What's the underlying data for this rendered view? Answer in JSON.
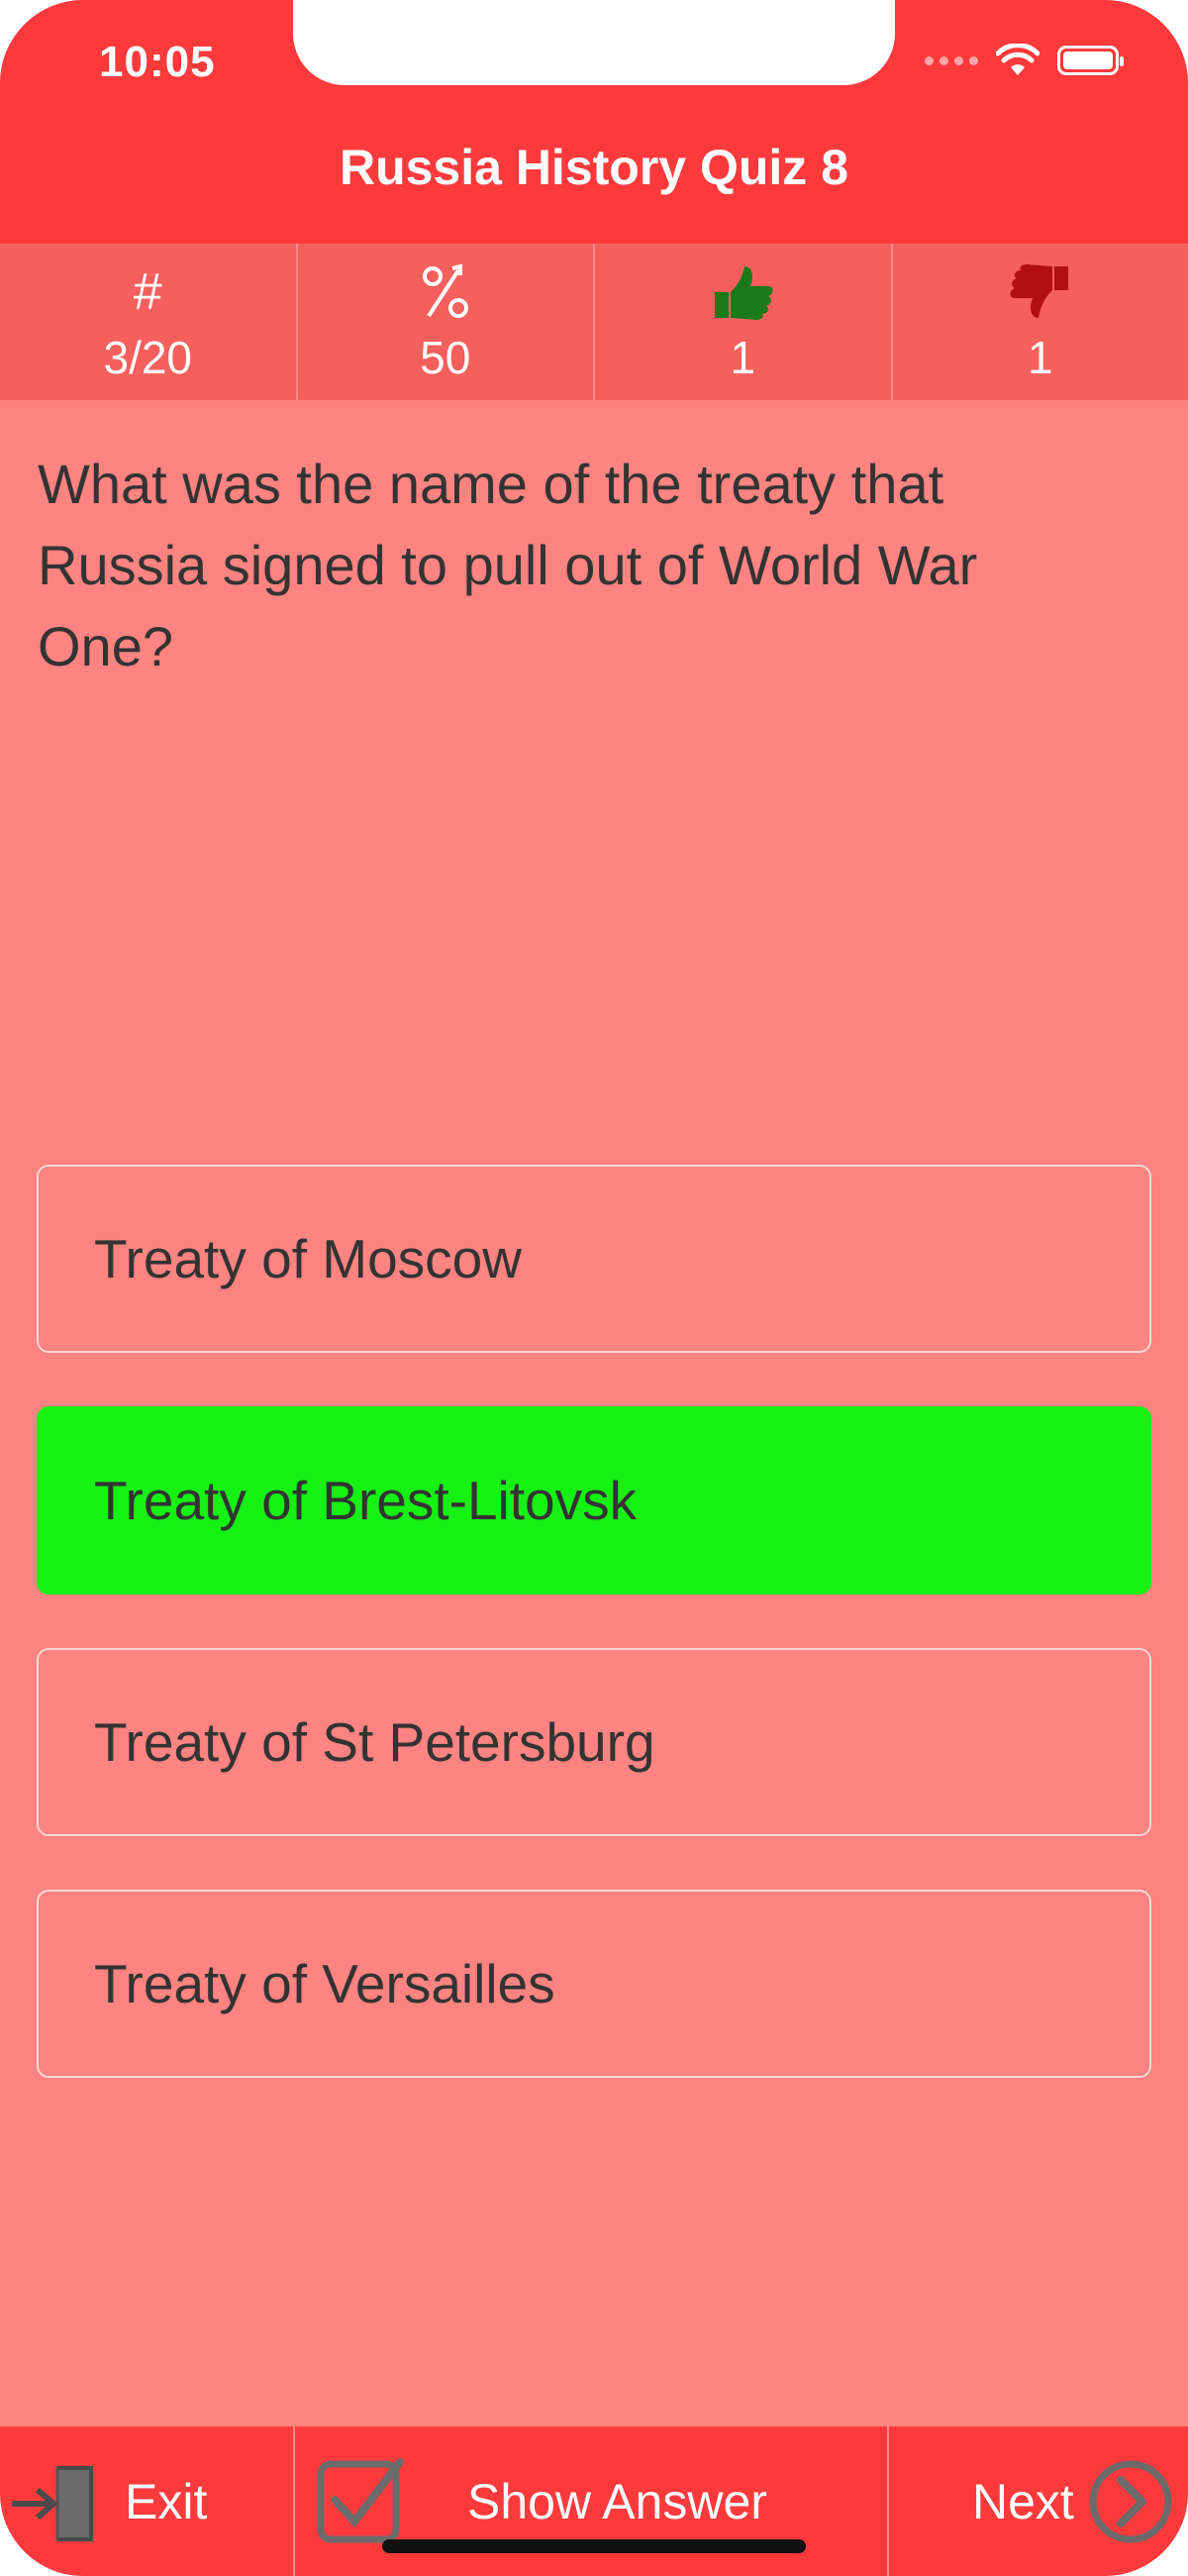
{
  "status_bar": {
    "time": "10:05"
  },
  "header": {
    "title": "Russia History Quiz 8"
  },
  "stats": [
    {
      "icon": "hash-icon",
      "symbol": "#",
      "value": "3/20"
    },
    {
      "icon": "percent-icon",
      "symbol": "%",
      "value": "50"
    },
    {
      "icon": "thumbs-up-icon",
      "symbol": "",
      "value": "1"
    },
    {
      "icon": "thumbs-down-icon",
      "symbol": "",
      "value": "1"
    }
  ],
  "question": {
    "text": "What was the name of the treaty that Russia signed to pull out of World War One?"
  },
  "answers": [
    {
      "label": "Treaty of Moscow",
      "state": "default"
    },
    {
      "label": "Treaty of Brest-Litovsk",
      "state": "correct"
    },
    {
      "label": "Treaty of St Petersburg",
      "state": "default"
    },
    {
      "label": "Treaty of Versailles",
      "state": "default"
    }
  ],
  "toolbar": {
    "exit_label": "Exit",
    "show_answer_label": "Show Answer",
    "next_label": "Next"
  },
  "colors": {
    "header": "#fc3a3c",
    "stats_bar": "#f55f5c",
    "background": "#fd8480",
    "correct": "#16f114",
    "thumbs_up": "#1a7a1a",
    "thumbs_down": "#b01010"
  }
}
